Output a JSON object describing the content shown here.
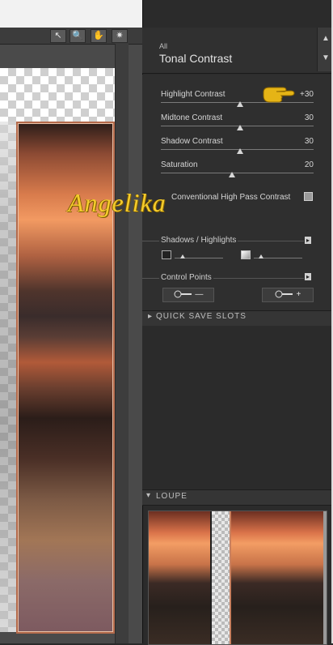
{
  "canvas": {
    "tools": [
      "↖",
      "🔍",
      "✋",
      "✷"
    ],
    "watermark": "Angelika"
  },
  "panel": {
    "category": "All",
    "title": "Tonal Contrast",
    "header_arrows": [
      "▲",
      "▼"
    ],
    "sliders": [
      {
        "label": "Highlight Contrast",
        "value": "+30",
        "level": 0.5
      },
      {
        "label": "Midtone Contrast",
        "value": "30",
        "level": 0.5
      },
      {
        "label": "Shadow Contrast",
        "value": "30",
        "level": 0.5
      },
      {
        "label": "Saturation",
        "value": "20",
        "level": 0.45
      }
    ],
    "checkbox_label": "Conventional High Pass Contrast",
    "shadows_highlights": "Shadows / Highlights",
    "control_points": "Control Points",
    "cp_add_symbol": "—",
    "cp_remove_symbol": "+",
    "expand_symbol": "▸",
    "quick_save": "QUICK SAVE SLOTS",
    "loupe": "LOUPE",
    "collapsed_arrow": "▸",
    "open_arrow": "▾"
  },
  "colors": {
    "accent_yellow": "#f5cc2c",
    "panel_bg": "#2b2b2b",
    "frame_border": "#b46a4b"
  }
}
